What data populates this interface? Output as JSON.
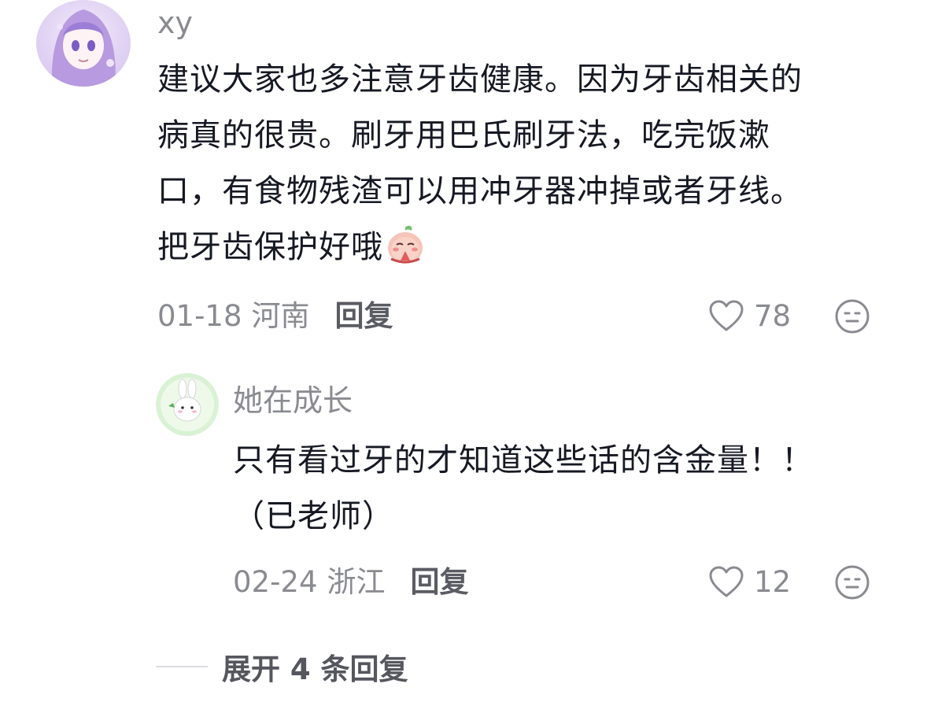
{
  "comments": [
    {
      "username": "xy",
      "lines": [
        "建议大家也多注意牙齿健康。因为牙齿相关的",
        "病真的很贵。刷牙用巴氏刷牙法，吃完饭漱",
        "口，有食物残渣可以用冲牙器冲掉或者牙线。",
        "把牙齿保护好哦"
      ],
      "sticker": "peach-praying-sticker",
      "date": "01-18",
      "region": "河南",
      "reply_label": "回复",
      "likes": "78",
      "avatar": "anime-girl-purple-avatar"
    },
    {
      "username": "她在成长",
      "lines": [
        "只有看过牙的才知道这些话的含金量！！",
        "（已老师）"
      ],
      "date": "02-24",
      "region": "浙江",
      "reply_label": "回复",
      "likes": "12",
      "avatar": "white-bunny-avatar"
    }
  ],
  "expand_label": "展开 4 条回复",
  "icons": {
    "like": "heart-outline-icon",
    "dislike": "neutral-face-icon"
  },
  "colors": {
    "text_primary": "#161823",
    "text_secondary": "#8a8b91",
    "reply": "#5a5b63"
  }
}
